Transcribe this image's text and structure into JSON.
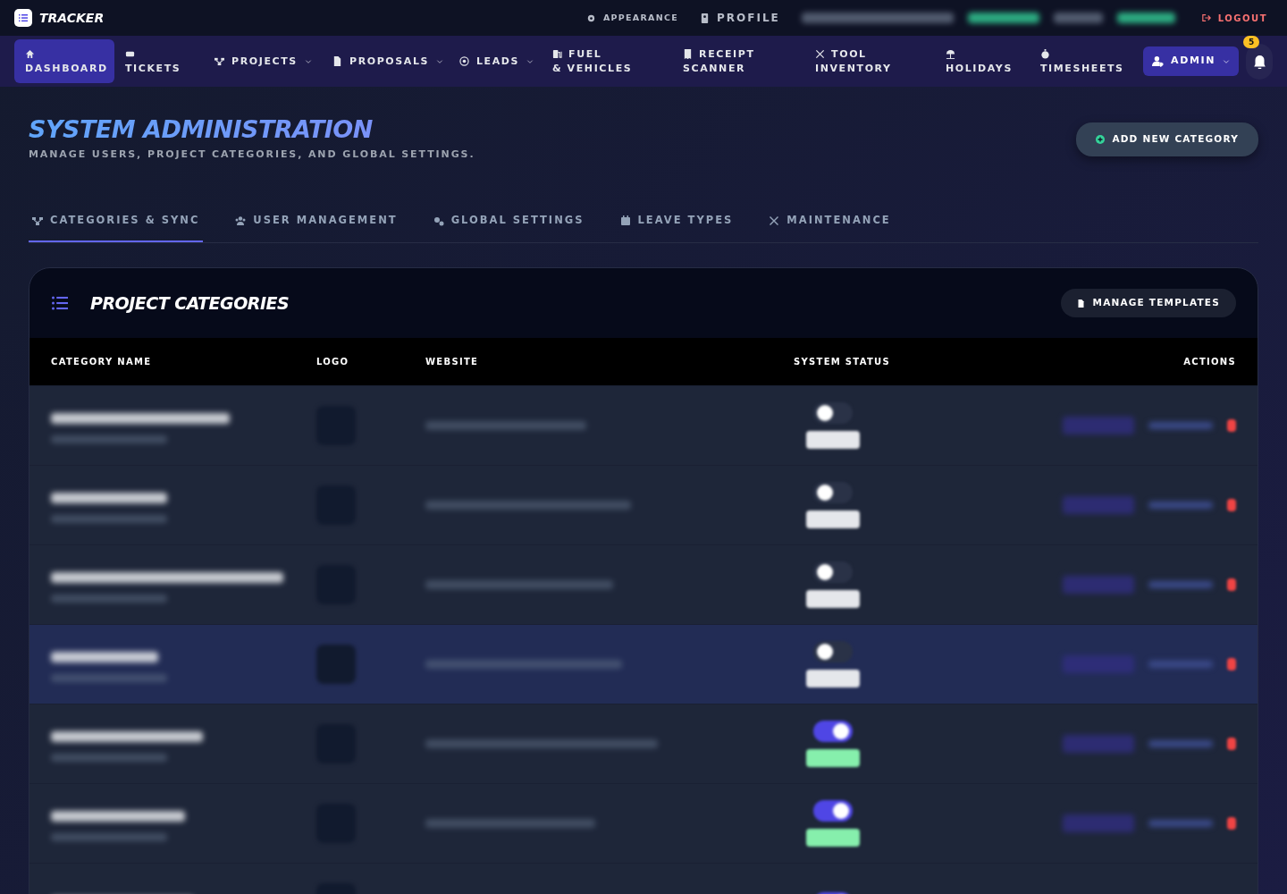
{
  "app": {
    "name": "TRACKER"
  },
  "top_links": [
    {
      "kind": "appearance",
      "label": "APPEARANCE"
    },
    {
      "kind": "profile",
      "label": "PROFILE"
    }
  ],
  "logout": "LOGOUT",
  "nav": [
    {
      "kind": "home",
      "label": "DASHBOARD",
      "selected": true,
      "dropdown": false
    },
    {
      "kind": "ticket",
      "label": "TICKETS",
      "selected": false,
      "dropdown": false
    },
    {
      "kind": "projects",
      "label": "PROJECTS",
      "selected": false,
      "dropdown": true
    },
    {
      "kind": "proposals",
      "label": "PROPOSALS",
      "selected": false,
      "dropdown": true
    },
    {
      "kind": "leads",
      "label": "LEADS",
      "selected": false,
      "dropdown": true
    },
    {
      "kind": "fuel",
      "label": "FUEL & VEHICLES",
      "selected": false,
      "dropdown": false
    },
    {
      "kind": "receipt",
      "label": "RECEIPT SCANNER",
      "selected": false,
      "dropdown": false
    },
    {
      "kind": "tools",
      "label": "TOOL INVENTORY",
      "selected": false,
      "dropdown": false
    },
    {
      "kind": "holidays",
      "label": "HOLIDAYS",
      "selected": false,
      "dropdown": false
    },
    {
      "kind": "timer",
      "label": "TIMESHEETS",
      "selected": false,
      "dropdown": false
    }
  ],
  "admin_menu": "ADMIN",
  "notifications": {
    "count": "5"
  },
  "page": {
    "title": "SYSTEM ADMINISTRATION",
    "subtitle": "MANAGE USERS, PROJECT CATEGORIES, AND GLOBAL SETTINGS.",
    "action": "ADD NEW CATEGORY"
  },
  "tabs": [
    {
      "kind": "projects",
      "label": "CATEGORIES & SYNC",
      "selected": true
    },
    {
      "kind": "users",
      "label": "USER MANAGEMENT",
      "selected": false
    },
    {
      "kind": "gears",
      "label": "GLOBAL SETTINGS",
      "selected": false
    },
    {
      "kind": "calendar",
      "label": "LEAVE TYPES",
      "selected": false
    },
    {
      "kind": "tools",
      "label": "MAINTENANCE",
      "selected": false
    }
  ],
  "panel": {
    "title": "PROJECT CATEGORIES",
    "action": "MANAGE TEMPLATES",
    "columns": [
      "CATEGORY NAME",
      "LOGO",
      "WEBSITE",
      "SYSTEM STATUS",
      "ACTIONS"
    ],
    "rows": [
      {
        "on": false,
        "highlighted": false
      },
      {
        "on": false,
        "highlighted": false
      },
      {
        "on": false,
        "highlighted": false
      },
      {
        "on": false,
        "highlighted": true
      },
      {
        "on": true,
        "highlighted": false
      },
      {
        "on": true,
        "highlighted": false
      },
      {
        "on": true,
        "highlighted": false
      }
    ]
  }
}
